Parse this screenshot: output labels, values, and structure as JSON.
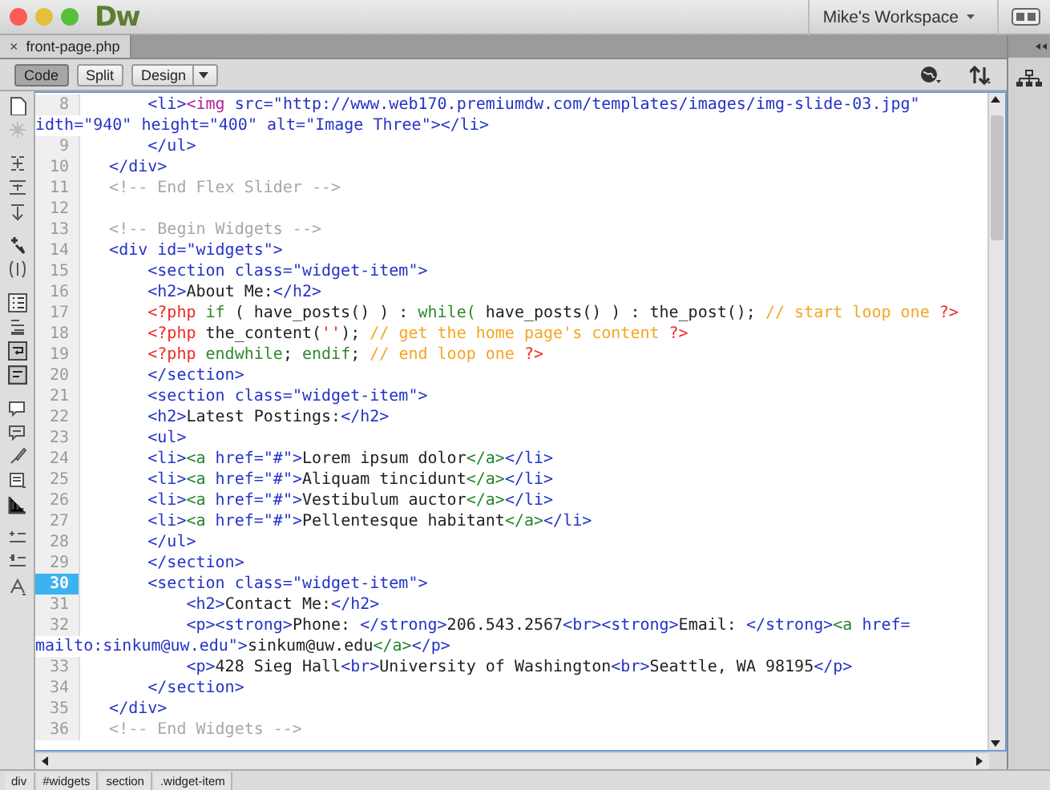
{
  "window": {
    "app_logo": "Dw",
    "workspace": "Mike's Workspace"
  },
  "document_tabs": [
    {
      "label": "front-page.php",
      "close": "×",
      "selected": true
    }
  ],
  "view_buttons": [
    {
      "label": "Code",
      "selected": true,
      "kind": "plain"
    },
    {
      "label": "Split",
      "selected": false,
      "kind": "plain"
    },
    {
      "label": "Design",
      "selected": false,
      "kind": "dropdown"
    }
  ],
  "code": {
    "lines": [
      {
        "children": [
          {
            "number": "8",
            "current": false,
            "wraps": [
              {
                "tokens": [
                  {
                    "kind": "tag",
                    "text": "<li>"
                  },
                  {
                    "kind": "img",
                    "text": "<img"
                  },
                  {
                    "kind": "tag",
                    "text": " src=\"http://www.web170.premiumdw.com/templates/images/img-slide-03.jpg\""
                  }
                ]
              },
              {
                "tokens": [
                  {
                    "kind": "tag",
                    "text": "idth=\"940\" height=\"400\" alt=\"Image Three\"></li>"
                  }
                ]
              }
            ]
          },
          {
            "number": "9",
            "current": false,
            "wraps": [
              {
                "tokens": [
                  {
                    "kind": "tag",
                    "text": "</ul>"
                  }
                ]
              }
            ]
          }
        ]
      },
      {
        "number": "10",
        "current": false,
        "wraps": [
          {
            "tokens": [
              {
                "kind": "tag",
                "text": "</div>"
              }
            ]
          }
        ]
      },
      {
        "number": "11",
        "current": false,
        "wraps": [
          {
            "tokens": [
              {
                "kind": "comment",
                "text": "<!-- End Flex Slider -->"
              }
            ]
          }
        ]
      },
      {
        "number": "12",
        "current": false
      },
      {
        "number": "13",
        "current": false,
        "wraps": [
          {
            "tokens": [
              {
                "kind": "comment",
                "text": "<!-- Begin Widgets -->"
              }
            ]
          }
        ]
      },
      {
        "number": "14",
        "current": false,
        "wraps": [
          {
            "tokens": [
              {
                "kind": "tag",
                "text": "<div id=\"widgets\">"
              }
            ]
          }
        ],
        "children": [
          {
            "number": "15",
            "current": false,
            "wraps": [
              {
                "tokens": [
                  {
                    "kind": "tag",
                    "text": "<section class=\"widget-item\">"
                  }
                ]
              }
            ]
          },
          {
            "number": "16",
            "current": false,
            "wraps": [
              {
                "tokens": [
                  {
                    "kind": "tag",
                    "text": "<h2>"
                  },
                  {
                    "kind": "text",
                    "text": "About Me:"
                  },
                  {
                    "kind": "tag",
                    "text": "</h2>"
                  }
                ]
              }
            ]
          },
          {
            "number": "17",
            "current": false,
            "wraps": [
              {
                "tokens": [
                  {
                    "kind": "php",
                    "text": "<?php"
                  },
                  {
                    "kind": "keyword",
                    "text": " if"
                  },
                  {
                    "kind": "text",
                    "text": " ( have_posts() ) : "
                  },
                  {
                    "kind": "keyword",
                    "text": "while("
                  },
                  {
                    "kind": "text",
                    "text": " have_posts() ) : the_post(); "
                  },
                  {
                    "kind": "php_comment",
                    "text": "// start loop one"
                  },
                  {
                    "kind": "php",
                    "text": " ?>"
                  }
                ]
              }
            ]
          },
          {
            "number": "18",
            "current": false,
            "wraps": [
              {
                "tokens": [
                  {
                    "kind": "php",
                    "text": "<?php"
                  },
                  {
                    "kind": "text",
                    "text": " the_content("
                  },
                  {
                    "kind": "php",
                    "text": "''"
                  },
                  {
                    "kind": "text",
                    "text": "); "
                  },
                  {
                    "kind": "php_comment",
                    "text": "// get the home page's content"
                  },
                  {
                    "kind": "php",
                    "text": " ?>"
                  }
                ]
              }
            ]
          },
          {
            "number": "19",
            "current": false,
            "wraps": [
              {
                "tokens": [
                  {
                    "kind": "php",
                    "text": "<?php"
                  },
                  {
                    "kind": "keyword",
                    "text": " endwhile"
                  },
                  {
                    "kind": "text",
                    "text": "; "
                  },
                  {
                    "kind": "keyword",
                    "text": "endif"
                  },
                  {
                    "kind": "text",
                    "text": "; "
                  },
                  {
                    "kind": "php_comment",
                    "text": "// end loop one"
                  },
                  {
                    "kind": "php",
                    "text": " ?>"
                  }
                ]
              }
            ]
          },
          {
            "number": "20",
            "current": false,
            "wraps": [
              {
                "tokens": [
                  {
                    "kind": "tag",
                    "text": "</section>"
                  }
                ]
              }
            ]
          },
          {
            "number": "21",
            "current": false,
            "wraps": [
              {
                "tokens": [
                  {
                    "kind": "tag",
                    "text": "<section class=\"widget-item\">"
                  }
                ]
              }
            ]
          },
          {
            "number": "22",
            "current": false,
            "wraps": [
              {
                "tokens": [
                  {
                    "kind": "tag",
                    "text": "<h2>"
                  },
                  {
                    "kind": "text",
                    "text": "Latest Postings:"
                  },
                  {
                    "kind": "tag",
                    "text": "</h2>"
                  }
                ]
              }
            ]
          },
          {
            "number": "23",
            "current": false,
            "wraps": [
              {
                "tokens": [
                  {
                    "kind": "tag",
                    "text": "<ul>"
                  }
                ]
              }
            ]
          },
          {
            "number": "24",
            "current": false,
            "wraps": [
              {
                "tokens": [
                  {
                    "kind": "tag",
                    "text": "<li>"
                  },
                  {
                    "kind": "link",
                    "text": "<a"
                  },
                  {
                    "kind": "tag",
                    "text": " href=\"#\">"
                  },
                  {
                    "kind": "text",
                    "text": "Lorem ipsum dolor"
                  },
                  {
                    "kind": "link",
                    "text": "</a>"
                  },
                  {
                    "kind": "tag",
                    "text": "</li>"
                  }
                ]
              }
            ]
          },
          {
            "number": "25",
            "current": false,
            "wraps": [
              {
                "tokens": [
                  {
                    "kind": "tag",
                    "text": "<li>"
                  },
                  {
                    "kind": "link",
                    "text": "<a"
                  },
                  {
                    "kind": "tag",
                    "text": " href=\"#\">"
                  },
                  {
                    "kind": "text",
                    "text": "Aliquam tincidunt"
                  },
                  {
                    "kind": "link",
                    "text": "</a>"
                  },
                  {
                    "kind": "tag",
                    "text": "</li>"
                  }
                ]
              }
            ]
          },
          {
            "number": "26",
            "current": false,
            "wraps": [
              {
                "tokens": [
                  {
                    "kind": "tag",
                    "text": "<li>"
                  },
                  {
                    "kind": "link",
                    "text": "<a"
                  },
                  {
                    "kind": "tag",
                    "text": " href=\"#\">"
                  },
                  {
                    "kind": "text",
                    "text": "Vestibulum auctor"
                  },
                  {
                    "kind": "link",
                    "text": "</a>"
                  },
                  {
                    "kind": "tag",
                    "text": "</li>"
                  }
                ]
              }
            ]
          },
          {
            "number": "27",
            "current": false,
            "wraps": [
              {
                "tokens": [
                  {
                    "kind": "tag",
                    "text": "<li>"
                  },
                  {
                    "kind": "link",
                    "text": "<a"
                  },
                  {
                    "kind": "tag",
                    "text": " href=\"#\">"
                  },
                  {
                    "kind": "text",
                    "text": "Pellentesque habitant"
                  },
                  {
                    "kind": "link",
                    "text": "</a>"
                  },
                  {
                    "kind": "tag",
                    "text": "</li>"
                  }
                ]
              }
            ]
          },
          {
            "number": "28",
            "current": false,
            "wraps": [
              {
                "tokens": [
                  {
                    "kind": "tag",
                    "text": "</ul>"
                  }
                ]
              }
            ]
          },
          {
            "number": "29",
            "current": false,
            "wraps": [
              {
                "tokens": [
                  {
                    "kind": "tag",
                    "text": "</section>"
                  }
                ]
              }
            ]
          },
          {
            "number": "30",
            "current": true,
            "wraps": [
              {
                "tokens": [
                  {
                    "kind": "tag",
                    "text": "<section class=\"widget-item\">"
                  }
                ]
              }
            ],
            "children": [
              {
                "number": "31",
                "current": false,
                "wraps": [
                  {
                    "tokens": [
                      {
                        "kind": "tag",
                        "text": "<h2>"
                      },
                      {
                        "kind": "text",
                        "text": "Contact Me:"
                      },
                      {
                        "kind": "tag",
                        "text": "</h2>"
                      }
                    ]
                  }
                ]
              },
              {
                "number": "32",
                "current": false,
                "wraps": [
                  {
                    "tokens": [
                      {
                        "kind": "tag",
                        "text": "<p><strong>"
                      },
                      {
                        "kind": "text",
                        "text": "Phone: "
                      },
                      {
                        "kind": "tag",
                        "text": "</strong>"
                      },
                      {
                        "kind": "text",
                        "text": "206.543.2567"
                      },
                      {
                        "kind": "tag",
                        "text": "<br><strong>"
                      },
                      {
                        "kind": "text",
                        "text": "Email: "
                      },
                      {
                        "kind": "tag",
                        "text": "</strong>"
                      },
                      {
                        "kind": "link",
                        "text": "<a"
                      },
                      {
                        "kind": "tag",
                        "text": " href="
                      }
                    ]
                  },
                  {
                    "tokens": [
                      {
                        "kind": "tag",
                        "text": "mailto:sinkum@uw.edu\">"
                      },
                      {
                        "kind": "text",
                        "text": "sinkum@uw.edu"
                      },
                      {
                        "kind": "link",
                        "text": "</a>"
                      },
                      {
                        "kind": "tag",
                        "text": "</p>"
                      }
                    ]
                  }
                ]
              },
              {
                "number": "33",
                "current": false,
                "wraps": [
                  {
                    "tokens": [
                      {
                        "kind": "tag",
                        "text": "<p>"
                      },
                      {
                        "kind": "text",
                        "text": "428 Sieg Hall"
                      },
                      {
                        "kind": "tag",
                        "text": "<br>"
                      },
                      {
                        "kind": "text",
                        "text": "University of Washington"
                      },
                      {
                        "kind": "tag",
                        "text": "<br>"
                      },
                      {
                        "kind": "text",
                        "text": "Seattle, WA 98195"
                      },
                      {
                        "kind": "tag",
                        "text": "</p>"
                      }
                    ]
                  }
                ]
              }
            ]
          },
          {
            "number": "34",
            "current": false,
            "wraps": [
              {
                "tokens": [
                  {
                    "kind": "tag",
                    "text": "</section>"
                  }
                ]
              }
            ]
          }
        ]
      },
      {
        "number": "35",
        "current": false,
        "wraps": [
          {
            "tokens": [
              {
                "kind": "tag",
                "text": "</div>"
              }
            ]
          }
        ]
      },
      {
        "number": "36",
        "current": false,
        "wraps": [
          {
            "tokens": [
              {
                "kind": "comment",
                "text": "<!-- End Widgets -->"
              }
            ]
          }
        ]
      }
    ]
  },
  "status_bar": {
    "tag_path": [
      "div",
      "#widgets",
      "section",
      ".widget-item"
    ]
  }
}
